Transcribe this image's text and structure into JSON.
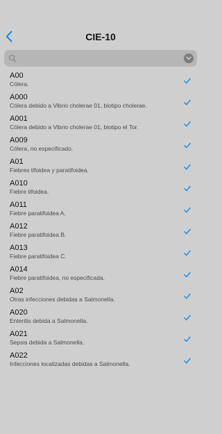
{
  "header": {
    "title": "CIE-10",
    "back_icon": "chevron-left-icon",
    "accent_color": "#1e8fe6"
  },
  "search": {
    "value": "",
    "placeholder": "",
    "icon": "search-icon",
    "dropdown_icon": "chevron-down-icon"
  },
  "list": {
    "items": [
      {
        "code": "A00",
        "desc": "Cólera.",
        "checked": true
      },
      {
        "code": "A000",
        "desc": "Cólera debido a Vibrio cholerae 01, biotipo cholerae.",
        "checked": true
      },
      {
        "code": "A001",
        "desc": "Cólera debido a Vibrio cholerae 01, biotipo el Tor.",
        "checked": true
      },
      {
        "code": "A009",
        "desc": "Cólera, no especificado.",
        "checked": true
      },
      {
        "code": "A01",
        "desc": "Fiebres tifoidea y paratifoidea.",
        "checked": true
      },
      {
        "code": "A010",
        "desc": "Fiebre tifoidea.",
        "checked": true
      },
      {
        "code": "A011",
        "desc": "Fiebre paratifoidea A.",
        "checked": true
      },
      {
        "code": "A012",
        "desc": "Fiebre paratifoidea B.",
        "checked": true
      },
      {
        "code": "A013",
        "desc": "Fiebre paratifoidea C.",
        "checked": true
      },
      {
        "code": "A014",
        "desc": "Fiebre paratifoidea, no especificada.",
        "checked": true
      },
      {
        "code": "A02",
        "desc": "Otras infecciones debidas a Salmonella.",
        "checked": true
      },
      {
        "code": "A020",
        "desc": "Enteritis debida a Salmonella.",
        "checked": true
      },
      {
        "code": "A021",
        "desc": "Sepsis debida a Salmonella.",
        "checked": true
      },
      {
        "code": "A022",
        "desc": "Infecciones localizadas debidas a Salmonella.",
        "checked": true
      }
    ]
  }
}
